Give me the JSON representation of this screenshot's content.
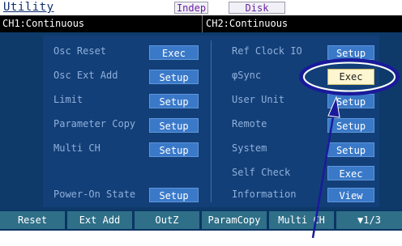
{
  "title": "Utility",
  "badges": {
    "indep": "Indep",
    "disk": "Disk"
  },
  "channels": {
    "ch1": "CH1:Continuous",
    "ch2": "CH2:Continuous"
  },
  "left_items": [
    {
      "label": "Osc Reset",
      "button": "Exec"
    },
    {
      "label": "Osc Ext Add",
      "button": "Setup"
    },
    {
      "label": "Limit",
      "button": "Setup"
    },
    {
      "label": "Parameter Copy",
      "button": "Setup"
    },
    {
      "label": "Multi CH",
      "button": "Setup"
    },
    {
      "label": "Power-On State",
      "button": "Setup"
    }
  ],
  "right_items": [
    {
      "label": "Ref Clock IO",
      "button": "Setup"
    },
    {
      "label": "φSync",
      "button": "Exec",
      "selected": true
    },
    {
      "label": "User Unit",
      "button": "Setup"
    },
    {
      "label": "Remote",
      "button": "Setup"
    },
    {
      "label": "System",
      "button": "Setup"
    },
    {
      "label": "Self Check",
      "button": "Exec"
    },
    {
      "label": "Information",
      "button": "View"
    }
  ],
  "function_keys": [
    "Reset",
    "Ext Add",
    "OutZ",
    "ParamCopy",
    "Multi CH",
    "▼1/3"
  ],
  "colors": {
    "screen_bg": "#0e3a6a",
    "button_bg": "#3a79c8",
    "selected_button_bg": "#fdf6d0",
    "label_text": "#8fb0dc",
    "function_key_bg": "#2f6f88",
    "annotation": "#1a1a9c"
  }
}
